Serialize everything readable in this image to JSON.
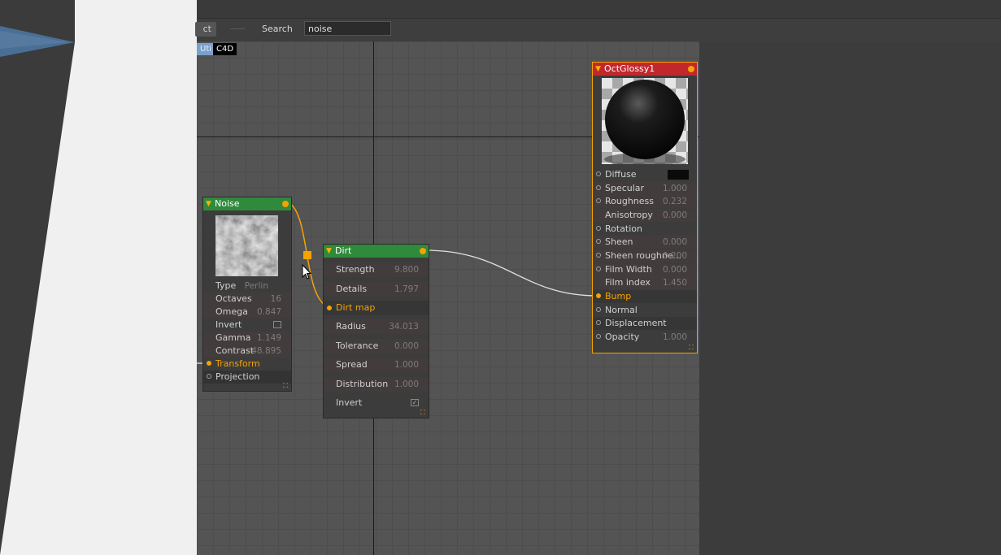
{
  "toolbar": {
    "object_button_label": "ct",
    "search_label": "Search",
    "search_value": "noise"
  },
  "category_tabs": [
    "Uti",
    "C4D"
  ],
  "nodes": {
    "noise": {
      "title": "Noise",
      "rows": [
        {
          "label": "Type",
          "value": "Perlin"
        },
        {
          "label": "Octaves",
          "value": "16"
        },
        {
          "label": "Omega",
          "value": "0.847"
        },
        {
          "label": "Invert",
          "value": ""
        },
        {
          "label": "Gamma",
          "value": "1.149"
        },
        {
          "label": "Contrast",
          "value": "48.895"
        },
        {
          "label": "Transform",
          "value": ""
        },
        {
          "label": "Projection",
          "value": ""
        }
      ]
    },
    "dirt": {
      "title": "Dirt",
      "rows": [
        {
          "label": "Strength",
          "value": "9.800"
        },
        {
          "label": "Details",
          "value": "1.797"
        },
        {
          "label": "Dirt map",
          "value": ""
        },
        {
          "label": "Radius",
          "value": "34.013"
        },
        {
          "label": "Tolerance",
          "value": "0.000"
        },
        {
          "label": "Spread",
          "value": "1.000"
        },
        {
          "label": "Distribution",
          "value": "1.000"
        },
        {
          "label": "Invert",
          "value": ""
        }
      ]
    },
    "glossy": {
      "title": "OctGlossy1",
      "rows": [
        {
          "label": "Diffuse",
          "value": ""
        },
        {
          "label": "Specular",
          "value": "1.000"
        },
        {
          "label": "Roughness",
          "value": "0.232"
        },
        {
          "label": "Anisotropy",
          "value": "0.000"
        },
        {
          "label": "Rotation",
          "value": ""
        },
        {
          "label": "Sheen",
          "value": "0.000"
        },
        {
          "label": "Sheen roughne...",
          "value": "0.200"
        },
        {
          "label": "Film Width",
          "value": "0.000"
        },
        {
          "label": "Film index",
          "value": "1.450"
        },
        {
          "label": "Bump",
          "value": ""
        },
        {
          "label": "Normal",
          "value": ""
        },
        {
          "label": "Displacement",
          "value": ""
        },
        {
          "label": "Opacity",
          "value": "1.000"
        }
      ]
    }
  },
  "colors": {
    "node_green": "#2f8a3c",
    "node_red": "#c0282d",
    "accent": "#f5a300",
    "canvas_bg": "#545454"
  }
}
